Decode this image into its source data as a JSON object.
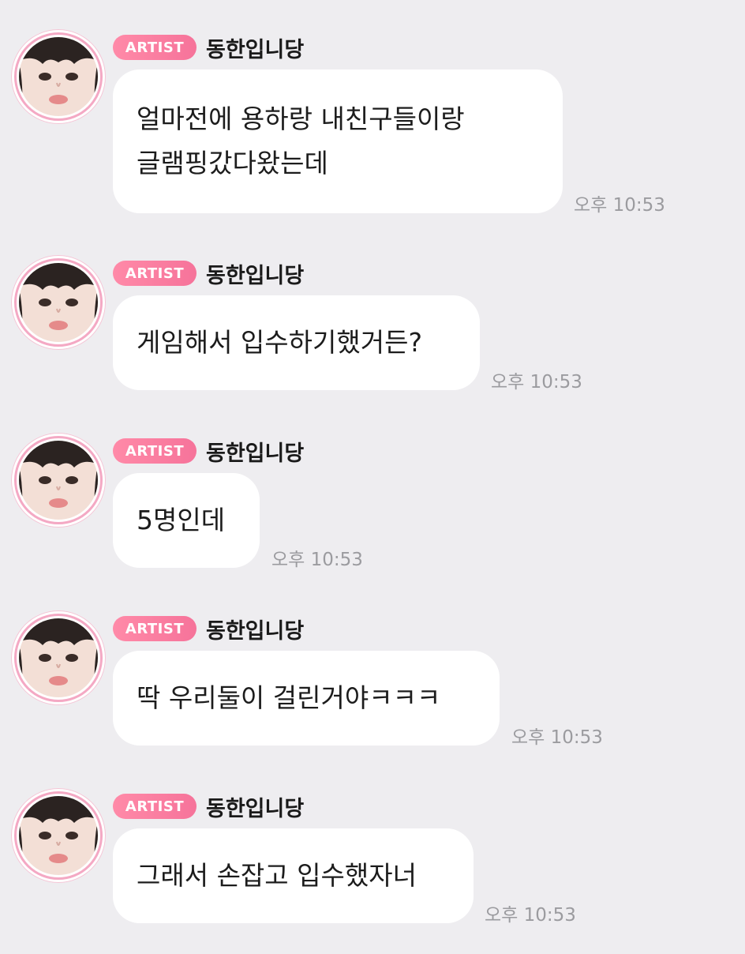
{
  "messages": [
    {
      "badge": "ARTIST",
      "sender": "동한입니당",
      "text": "얼마전에 용하랑 내친구들이랑\n글램핑갔다왔는데",
      "time": "오후 10:53"
    },
    {
      "badge": "ARTIST",
      "sender": "동한입니당",
      "text": "게임해서 입수하기했거든?",
      "time": "오후 10:53"
    },
    {
      "badge": "ARTIST",
      "sender": "동한입니당",
      "text": "5명인데",
      "time": "오후 10:53"
    },
    {
      "badge": "ARTIST",
      "sender": "동한입니당",
      "text": "딱 우리둘이 걸린거야ㅋㅋㅋ",
      "time": "오후 10:53"
    },
    {
      "badge": "ARTIST",
      "sender": "동한입니당",
      "text": "그래서 손잡고 입수했자너",
      "time": "오후 10:53"
    }
  ],
  "colors": {
    "background": "#eeedf0",
    "badge": "#f6739a",
    "avatar_ring": "#f4a9c4",
    "bubble": "#ffffff",
    "timestamp": "#9b9b9f"
  }
}
